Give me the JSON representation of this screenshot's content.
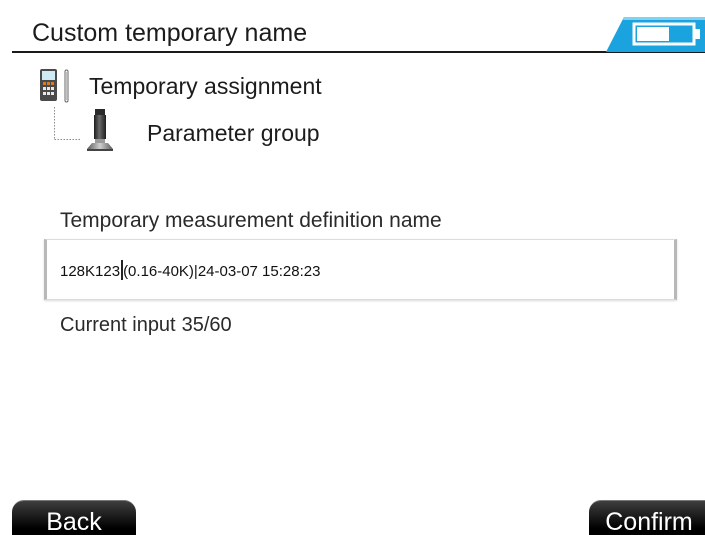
{
  "header": {
    "title": "Custom temporary name",
    "battery_icon": "battery-icon",
    "accent_color": "#1aa3de"
  },
  "tree": {
    "root": {
      "icon": "handheld-device-icon",
      "label": "Temporary assignment"
    },
    "child": {
      "icon": "sensor-probe-icon",
      "label": "Parameter group"
    }
  },
  "form": {
    "field_label": "Temporary measurement definition name",
    "value_before_caret": "128K123",
    "value_after_caret": "(0.16-40K)|24-03-07 15:28:23",
    "counter_label": "Current input",
    "counter_value": "35/60"
  },
  "footer": {
    "back_label": "Back",
    "confirm_label": "Confirm"
  }
}
